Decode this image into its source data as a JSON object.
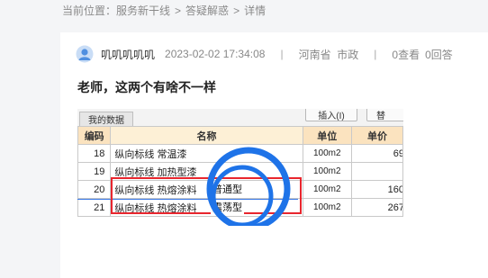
{
  "breadcrumb": {
    "prefix": "当前位置：",
    "items": [
      "服务新干线",
      "答疑解惑",
      "详情"
    ],
    "sep": ">"
  },
  "post": {
    "author": "叽叽叽叽叽",
    "time": "2023-02-02 17:34:08",
    "separator": "|",
    "province": "河南省",
    "category": "市政",
    "views": "0查看",
    "answers": "0回答",
    "title": "老师，这两个有啥不一样"
  },
  "screenshot": {
    "tab_label": "我的数据",
    "button_import": "插入(I)",
    "button_cut": "替",
    "headers": [
      "编码",
      "名称",
      "单位",
      "单价"
    ],
    "rows": [
      {
        "code": "18",
        "name": "纵向标线 常温漆",
        "unit": "100m2",
        "price": "69"
      },
      {
        "code": "19",
        "name": "纵向标线 加热型漆",
        "unit": "100m2",
        "price": ""
      },
      {
        "code": "20",
        "name": "纵向标线 热熔涂料",
        "unit": "100m2",
        "price": "160"
      },
      {
        "code": "21",
        "name": "纵向标线 热熔涂料",
        "unit": "100m2",
        "price": "267"
      }
    ],
    "annotations": [
      "普通型",
      "震荡型"
    ],
    "annotation_colors": {
      "box": "#e8262e",
      "circle": "#1e73e8",
      "line": "#3a78e6"
    }
  }
}
